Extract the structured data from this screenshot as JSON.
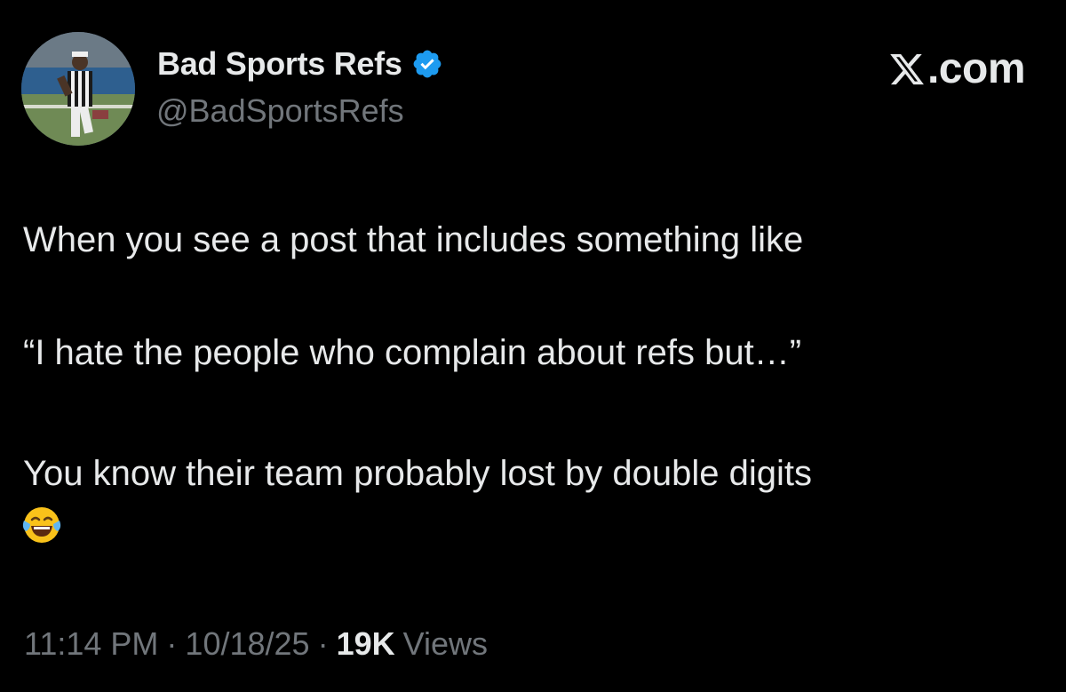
{
  "author": {
    "display_name": "Bad Sports Refs",
    "handle": "@BadSportsRefs",
    "verified": true,
    "verified_color": "#1d9bf0"
  },
  "brand": {
    "label": ".com",
    "icon": "x-logo-icon"
  },
  "post": {
    "line1": "When you see a post that includes something like",
    "line2": "“I hate the people who complain about refs but…”",
    "line3": "You know their team probably lost by double digits",
    "emoji": "face-with-tears-of-joy-icon"
  },
  "meta": {
    "time": "11:14 PM",
    "separator": "·",
    "date": "10/18/25",
    "views_count": "19K",
    "views_label": "Views"
  },
  "colors": {
    "background": "#000000",
    "primary_text": "#e7e9ea",
    "secondary_text": "#71767b"
  }
}
